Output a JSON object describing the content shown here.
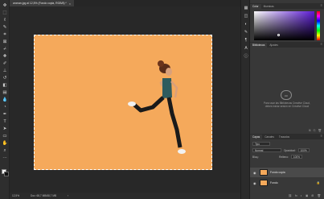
{
  "document": {
    "tab_title": "woman.jpg al 12,5% (Fondo copia, RGB/8) *",
    "close_label": "×"
  },
  "status": {
    "zoom": "12,5%",
    "doc_size": "Doc: 68,7 MB/68,7 MB",
    "arrow": "›"
  },
  "toolbar": {
    "tools": [
      {
        "name": "move-tool-icon",
        "glyph": "✥"
      },
      {
        "name": "marquee-tool-icon",
        "glyph": "⬚"
      },
      {
        "name": "lasso-tool-icon",
        "glyph": "ℓ"
      },
      {
        "name": "quick-select-tool-icon",
        "glyph": "✎"
      },
      {
        "name": "crop-tool-icon",
        "glyph": "⌗"
      },
      {
        "name": "frame-tool-icon",
        "glyph": "⊠"
      },
      {
        "name": "eyedropper-tool-icon",
        "glyph": "⌿"
      },
      {
        "name": "healing-brush-tool-icon",
        "glyph": "✚"
      },
      {
        "name": "brush-tool-icon",
        "glyph": "✐"
      },
      {
        "name": "clone-stamp-tool-icon",
        "glyph": "⊥"
      },
      {
        "name": "history-brush-tool-icon",
        "glyph": "↺"
      },
      {
        "name": "eraser-tool-icon",
        "glyph": "◧"
      },
      {
        "name": "gradient-tool-icon",
        "glyph": "▤"
      },
      {
        "name": "blur-tool-icon",
        "glyph": "💧"
      },
      {
        "name": "dodge-tool-icon",
        "glyph": "◔"
      },
      {
        "name": "pen-tool-icon",
        "glyph": "✒"
      },
      {
        "name": "type-tool-icon",
        "glyph": "T"
      },
      {
        "name": "path-select-tool-icon",
        "glyph": "➤"
      },
      {
        "name": "shape-tool-icon",
        "glyph": "▭"
      },
      {
        "name": "hand-tool-icon",
        "glyph": "✋"
      },
      {
        "name": "zoom-tool-icon",
        "glyph": "⌕"
      },
      {
        "name": "more-tools-icon",
        "glyph": "···"
      }
    ]
  },
  "mid_strip": {
    "icons": [
      {
        "name": "history-panel-icon",
        "glyph": "▦"
      },
      {
        "name": "properties-panel-icon",
        "glyph": "◫"
      },
      {
        "name": "adjust-panel-icon",
        "glyph": "◐"
      },
      {
        "name": "brushes-panel-icon",
        "glyph": "✎"
      },
      {
        "name": "paragraph-panel-icon",
        "glyph": "¶"
      },
      {
        "name": "glyphs-panel-icon",
        "glyph": "A"
      },
      {
        "name": "info-panel-icon",
        "glyph": "ⓘ"
      }
    ]
  },
  "color_panel": {
    "tabs": [
      "Color",
      "Muestras"
    ],
    "menu": "≡"
  },
  "libraries_panel": {
    "tabs": [
      "Bibliotecas",
      "Ajustes"
    ],
    "menu": "≡",
    "cc_icon": "cc",
    "message": "Para usar las Bibliotecas Creative Cloud, debes iniciar sesión en Creative Cloud",
    "bottom_icons": [
      "⊞",
      "⎘",
      "🗑"
    ]
  },
  "layers_panel": {
    "tabs": [
      "Capas",
      "Canales",
      "Trazados"
    ],
    "menu": "≡",
    "filter_label": "Tipo",
    "blend_mode": "Normal",
    "opacity_label": "Opacidad:",
    "opacity_value": "100%",
    "lock_label": "Bloq.:",
    "fill_label": "Relleno:",
    "fill_value": "100%",
    "layers": [
      {
        "name": "Fondo copia",
        "selected": true
      },
      {
        "name": "Fondo",
        "selected": false,
        "locked": true
      }
    ],
    "footer_icons": [
      "⛓",
      "fx",
      "◐",
      "▣",
      "⊞",
      "🗑"
    ]
  },
  "colors": {
    "canvas_background": "#f5a95b",
    "ui_dark": "#323232",
    "panel": "#383838"
  }
}
